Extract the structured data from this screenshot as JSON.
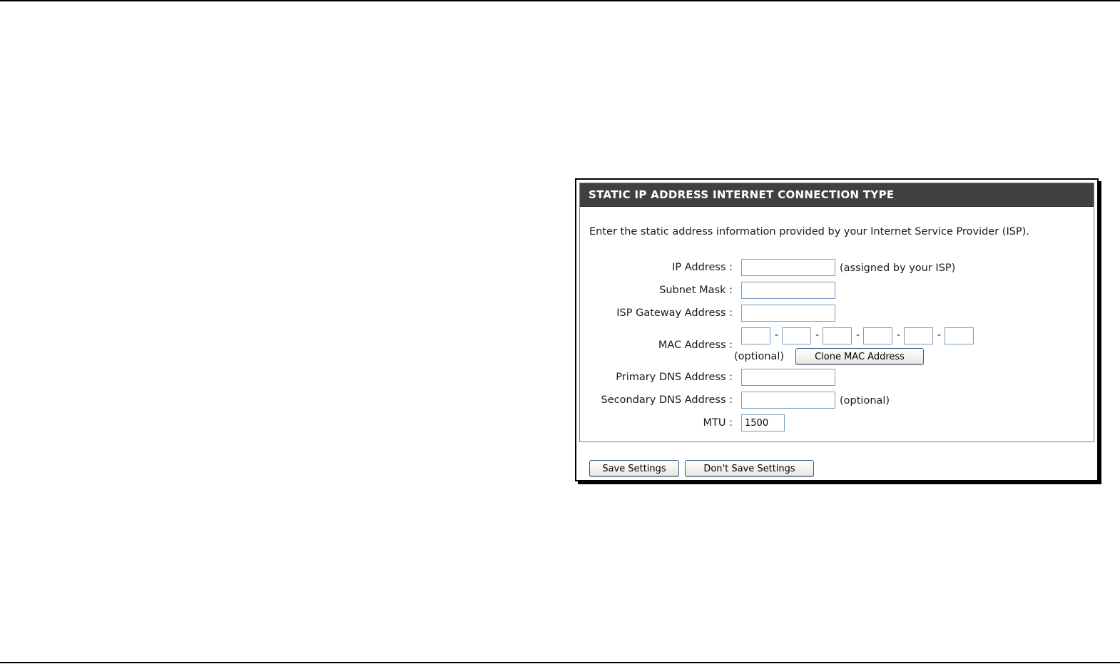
{
  "panel": {
    "title": "STATIC IP ADDRESS INTERNET CONNECTION TYPE",
    "intro": "Enter the static address information provided by your Internet Service Provider (ISP)."
  },
  "fields": {
    "ip_address": {
      "label": "IP Address :",
      "value": "",
      "note": "(assigned by your ISP)"
    },
    "subnet_mask": {
      "label": "Subnet Mask :",
      "value": ""
    },
    "isp_gateway": {
      "label": "ISP Gateway Address :",
      "value": ""
    },
    "mac_address": {
      "label": "MAC Address :",
      "octets": [
        "",
        "",
        "",
        "",
        "",
        ""
      ],
      "separator": "-",
      "note": "(optional)",
      "clone_button": "Clone MAC Address"
    },
    "primary_dns": {
      "label": "Primary DNS Address :",
      "value": ""
    },
    "secondary_dns": {
      "label": "Secondary DNS Address :",
      "value": "",
      "note": "(optional)"
    },
    "mtu": {
      "label": "MTU :",
      "value": "1500"
    }
  },
  "buttons": {
    "save": "Save Settings",
    "dont_save": "Don't Save Settings"
  },
  "colors": {
    "header_bg": "#404040",
    "header_text": "#ffffff",
    "input_border": "#7b9ebd"
  }
}
